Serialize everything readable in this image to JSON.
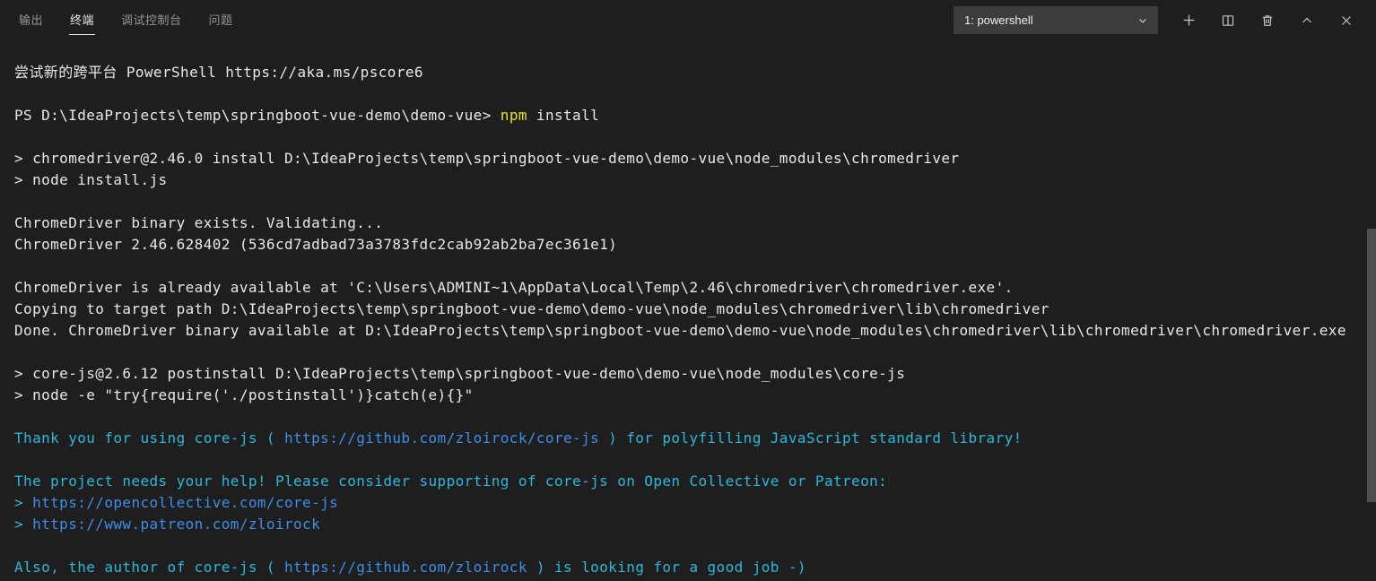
{
  "panel": {
    "tabs": [
      {
        "label": "输出",
        "active": false
      },
      {
        "label": "终端",
        "active": true
      },
      {
        "label": "调试控制台",
        "active": false
      },
      {
        "label": "问题",
        "active": false
      }
    ],
    "terminal_selector": {
      "value": "1: powershell",
      "icon": "chevron-down-icon"
    },
    "actions": [
      {
        "icon": "plus-icon"
      },
      {
        "icon": "split-terminal-icon"
      },
      {
        "icon": "trash-icon"
      },
      {
        "icon": "chevron-up-icon"
      },
      {
        "icon": "close-icon"
      }
    ]
  },
  "colors": {
    "background": "#1e1e1e",
    "foreground": "#e8e8e8",
    "ansi_yellow": "#e5e510",
    "ansi_bright_cyan": "#29b8db",
    "ansi_bright_blue": "#3b8eea",
    "tab_inactive": "#969696",
    "tab_active": "#e7e7e7",
    "select_background": "#3c3c3c",
    "icon": "#c5c5c5",
    "scrollbar": "#4f4f4f"
  },
  "terminal": {
    "lines": [
      {
        "spans": [
          {
            "t": "尝试新的跨平台 PowerShell https://aka.ms/pscore6",
            "c": "fg"
          }
        ]
      },
      {
        "spans": []
      },
      {
        "spans": [
          {
            "t": "PS D:\\IdeaProjects\\temp\\springboot-vue-demo\\demo-vue> ",
            "c": "fg"
          },
          {
            "t": "npm",
            "c": "yellow"
          },
          {
            "t": " install",
            "c": "fg"
          }
        ]
      },
      {
        "spans": []
      },
      {
        "spans": [
          {
            "t": "> chromedriver@2.46.0 install D:\\IdeaProjects\\temp\\springboot-vue-demo\\demo-vue\\node_modules\\chromedriver",
            "c": "fg"
          }
        ]
      },
      {
        "spans": [
          {
            "t": "> node install.js",
            "c": "fg"
          }
        ]
      },
      {
        "spans": []
      },
      {
        "spans": [
          {
            "t": "ChromeDriver binary exists. Validating...",
            "c": "fg"
          }
        ]
      },
      {
        "spans": [
          {
            "t": "ChromeDriver 2.46.628402 (536cd7adbad73a3783fdc2cab92ab2ba7ec361e1)",
            "c": "fg"
          }
        ]
      },
      {
        "spans": []
      },
      {
        "spans": [
          {
            "t": "ChromeDriver is already available at 'C:\\Users\\ADMINI~1\\AppData\\Local\\Temp\\2.46\\chromedriver\\chromedriver.exe'.",
            "c": "fg"
          }
        ]
      },
      {
        "spans": [
          {
            "t": "Copying to target path D:\\IdeaProjects\\temp\\springboot-vue-demo\\demo-vue\\node_modules\\chromedriver\\lib\\chromedriver",
            "c": "fg"
          }
        ]
      },
      {
        "spans": [
          {
            "t": "Done. ChromeDriver binary available at D:\\IdeaProjects\\temp\\springboot-vue-demo\\demo-vue\\node_modules\\chromedriver\\lib\\chromedriver\\chromedriver.exe",
            "c": "fg"
          }
        ]
      },
      {
        "spans": []
      },
      {
        "spans": [
          {
            "t": "> core-js@2.6.12 postinstall D:\\IdeaProjects\\temp\\springboot-vue-demo\\demo-vue\\node_modules\\core-js",
            "c": "fg"
          }
        ]
      },
      {
        "spans": [
          {
            "t": "> node -e \"try{require('./postinstall')}catch(e){}\"",
            "c": "fg"
          }
        ]
      },
      {
        "spans": []
      },
      {
        "spans": [
          {
            "t": "Thank you for using core-js (",
            "c": "cyan"
          },
          {
            "t": " https://github.com/zloirock/core-js ",
            "c": "blue",
            "link": true
          },
          {
            "t": ") for polyfilling JavaScript standard library!",
            "c": "cyan"
          }
        ]
      },
      {
        "spans": []
      },
      {
        "spans": [
          {
            "t": "The project needs your help! Please consider supporting of core-js on Open Collective or Patreon: ",
            "c": "cyan"
          }
        ]
      },
      {
        "spans": [
          {
            "t": "> ",
            "c": "cyan"
          },
          {
            "t": "https://opencollective.com/core-js ",
            "c": "blue",
            "link": true
          }
        ]
      },
      {
        "spans": [
          {
            "t": "> ",
            "c": "cyan"
          },
          {
            "t": "https://www.patreon.com/zloirock ",
            "c": "blue",
            "link": true
          }
        ]
      },
      {
        "spans": []
      },
      {
        "spans": [
          {
            "t": "Also, the author of core-js (",
            "c": "cyan"
          },
          {
            "t": " https://github.com/zloirock ",
            "c": "blue",
            "link": true
          },
          {
            "t": ") is looking for a good job -)",
            "c": "cyan"
          }
        ]
      }
    ]
  }
}
